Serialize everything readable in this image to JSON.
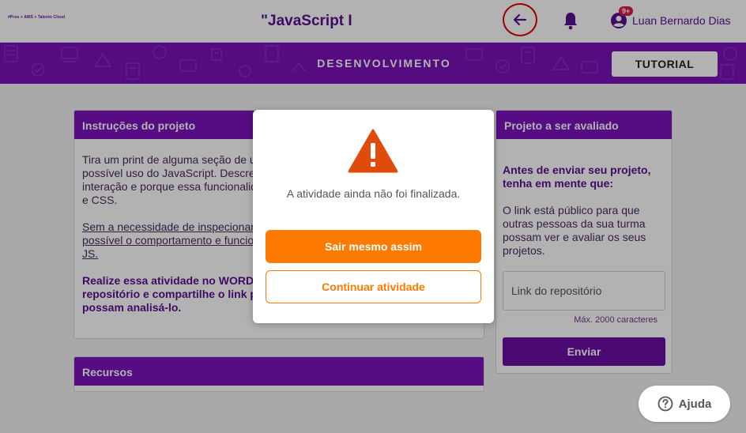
{
  "header": {
    "logo_text": "#Pros + AWS + Talento Cloud",
    "course_title": "\"JavaScript I",
    "back_icon": "arrow-left-icon",
    "bell_icon": "bell-icon",
    "notification_badge": "9+",
    "user_name": "Luan Bernardo Dias"
  },
  "band": {
    "title": "DESENVOLVIMENTO",
    "tutorial_label": "TUTORIAL"
  },
  "instructions": {
    "header": "Instruções do projeto",
    "p1": "Tira um print de alguma seção de um site onde você tenha identificado o possível uso do JavaScript. Descreva qual seria a funcionalidadeatravés da interação e porque essa funcionalidade não daria para fazer apenas com HTML e CSS.",
    "p2": "Sem a necessidade de inspecionar o código, descreva de forma detalhada possível o comportamento e funcionalidade que tornam necessário o uso de JS.",
    "p3": "Realize essa atividade no WORD ou documento similar, suba para algum repositório e compartilhe o link para que os demais desenvolvedores possam analisá-lo."
  },
  "resources": {
    "header": "Recursos"
  },
  "project": {
    "header": "Projeto a ser avaliado",
    "heading": "Antes de enviar seu projeto, tenha em mente que:",
    "text": "O link está público para que outras pessoas da sua turma possam ver e avaliar os seus projetos.",
    "input_placeholder": "Link do repositório",
    "max_chars": "Máx. 2000 caracteres",
    "send_label": "Enviar"
  },
  "modal": {
    "icon": "warning-icon",
    "message": "A atividade ainda não foi finalizada.",
    "exit_label": "Sair mesmo assim",
    "continue_label": "Continuar atividade"
  },
  "help": {
    "label": "Ajuda",
    "icon": "question-circle-icon"
  },
  "colors": {
    "primary_purple": "#7c14bd",
    "accent_orange": "#ff7a00",
    "warning_red": "#e04a0a",
    "badge_red": "#d81b46"
  }
}
